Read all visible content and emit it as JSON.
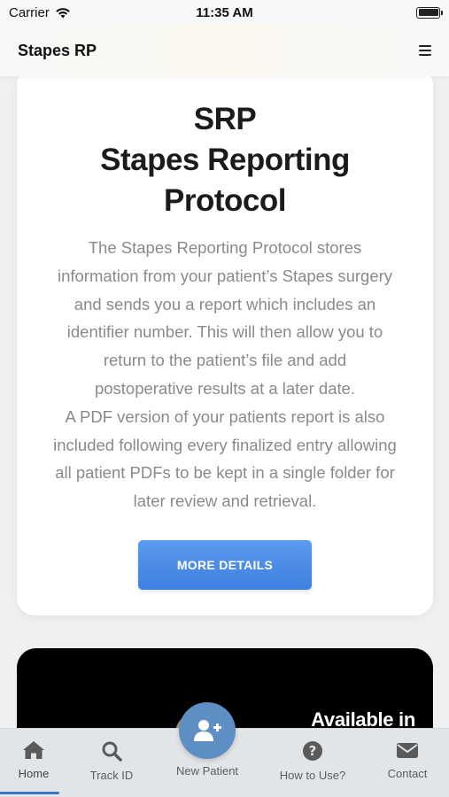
{
  "status_bar": {
    "carrier": "Carrier",
    "time": "11:35 AM",
    "icons": [
      "wifi-icon",
      "battery-icon"
    ]
  },
  "nav": {
    "title": "Stapes RP",
    "menu_icon": "hamburger-menu-icon"
  },
  "card": {
    "title_lines": [
      "SRP",
      "Stapes Reporting",
      "Protocol"
    ],
    "description_lines": [
      "The Stapes Reporting Protocol stores",
      "information from your patient’s Stapes surgery",
      "and sends you a report which includes an",
      "identifier number. This will then allow you to",
      "return to the patient’s file and add",
      "postoperative results at a later date.",
      "A PDF version of your patients report is also",
      "included following every finalized entry allowing",
      "all patient PDFs to be kept in a single folder for",
      "later review and retrieval."
    ],
    "button_label": "MORE DETAILS"
  },
  "promo": {
    "text": "Available in"
  },
  "tabs": [
    {
      "label": "Home",
      "icon": "home-icon",
      "active": true
    },
    {
      "label": "Track ID",
      "icon": "search-icon",
      "active": false
    },
    {
      "label": "New Patient",
      "icon": "add-user-icon",
      "active": false
    },
    {
      "label": "How to Use?",
      "icon": "question-circle-icon",
      "active": false
    },
    {
      "label": "Contact",
      "icon": "envelope-icon",
      "active": false
    }
  ],
  "colors": {
    "accent": "#3f7fe0",
    "fab": "#5e8fc4",
    "tab_indicator": "#3b74c9",
    "description_text": "#8a8a8a"
  }
}
